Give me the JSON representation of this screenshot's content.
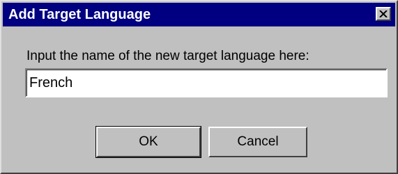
{
  "window": {
    "title": "Add Target Language",
    "close_icon": "close-icon"
  },
  "form": {
    "prompt": "Input the name of the new target language here:",
    "language_value": "French"
  },
  "buttons": {
    "ok_label": "OK",
    "cancel_label": "Cancel"
  }
}
